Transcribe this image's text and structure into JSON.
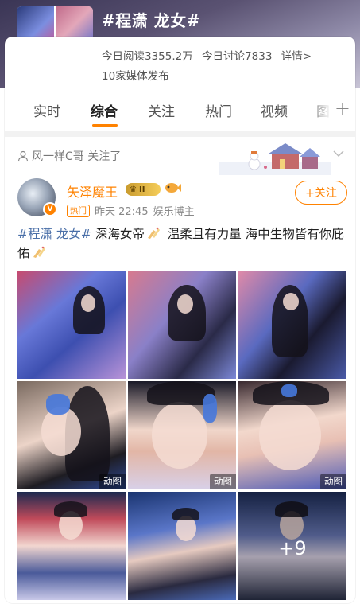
{
  "topic": {
    "title": "#程潇 龙女#",
    "stats": [
      "今日阅读3355.2万",
      "今日讨论7833",
      "详情>"
    ],
    "media": "10家媒体发布"
  },
  "tabs": [
    "实时",
    "综合",
    "关注",
    "热门",
    "视频",
    "图"
  ],
  "active_tab": "综合",
  "notice": "风一样C哥 关注了",
  "post": {
    "author": "矢泽魔王",
    "level_badge": "II",
    "hot_tag": "热门",
    "time": "昨天 22:45",
    "source": "娱乐博主",
    "follow_label": "+关注",
    "text_hashtag": "#程潇 龙女#",
    "text_part1": "深海女帝",
    "text_part2": "温柔且有力量 海中生物皆有你庇佑",
    "images": [
      {
        "badge": ""
      },
      {
        "badge": ""
      },
      {
        "badge": ""
      },
      {
        "badge": "动图"
      },
      {
        "badge": "动图"
      },
      {
        "badge": "动图"
      },
      {
        "badge": ""
      },
      {
        "badge": ""
      },
      {
        "badge": ""
      }
    ],
    "more_count": "+9"
  },
  "colors": {
    "accent": "#ff8200",
    "hashtag": "#4a6fa8"
  }
}
